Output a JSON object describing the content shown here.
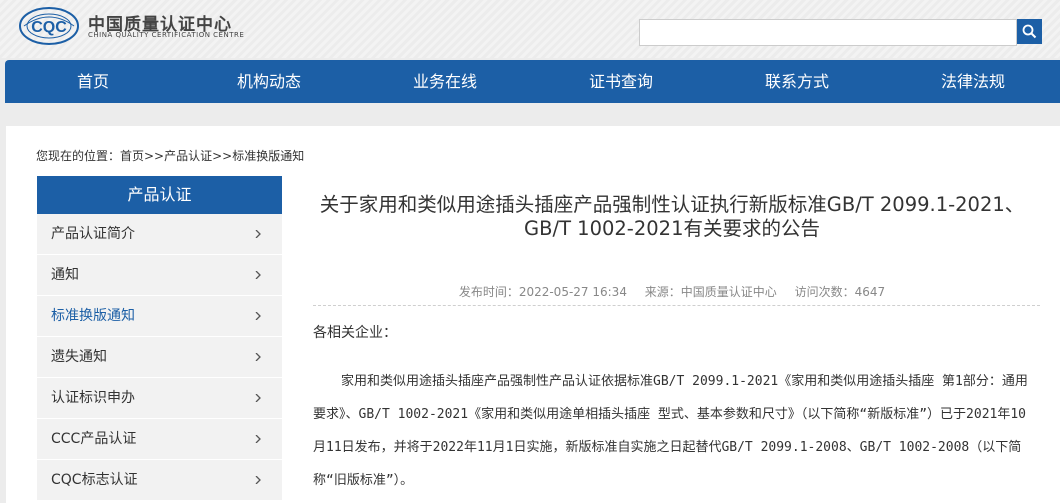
{
  "header": {
    "logo_text": "CQC",
    "org_name_cn": "中国质量认证中心",
    "org_name_en": "CHINA QUALITY CERTIFICATION CENTRE"
  },
  "search": {
    "placeholder": "",
    "value": ""
  },
  "nav": {
    "items": [
      {
        "label": "首页"
      },
      {
        "label": "机构动态"
      },
      {
        "label": "业务在线"
      },
      {
        "label": "证书查询"
      },
      {
        "label": "联系方式"
      },
      {
        "label": "法律法规"
      }
    ]
  },
  "breadcrumb": "您现在的位置：首页>>产品认证>>标准换版通知",
  "sidebar": {
    "title": "产品认证",
    "items": [
      {
        "label": "产品认证简介"
      },
      {
        "label": "通知"
      },
      {
        "label": "标准换版通知"
      },
      {
        "label": "遗失通知"
      },
      {
        "label": "认证标识申办"
      },
      {
        "label": "CCC产品认证"
      },
      {
        "label": "CQC标志认证"
      }
    ]
  },
  "article": {
    "title": "关于家用和类似用途插头插座产品强制性认证执行新版标准GB/T 2099.1-2021、GB/T 1002-2021有关要求的公告",
    "publish_time": "发布时间：2022-05-27 16:34",
    "source": "来源：中国质量认证中心",
    "visits": "访问次数：4647",
    "greeting": "各相关企业：",
    "paragraph": "家用和类似用途插头插座产品强制性产品认证依据标准GB/T 2099.1-2021《家用和类似用途插头插座 第1部分：通用要求》、GB/T 1002-2021《家用和类似用途单相插头插座 型式、基本参数和尺寸》（以下简称“新版标准”）已于2021年10月11日发布，并将于2022年11月1日实施，新版标准自实施之日起替代GB/T 2099.1-2008、GB/T 1002-2008（以下简称“旧版标准”）。"
  },
  "colors": {
    "brand": "#1c5fa6",
    "sidebar_bg": "#f2f2f2",
    "page_bg": "#ececec"
  }
}
